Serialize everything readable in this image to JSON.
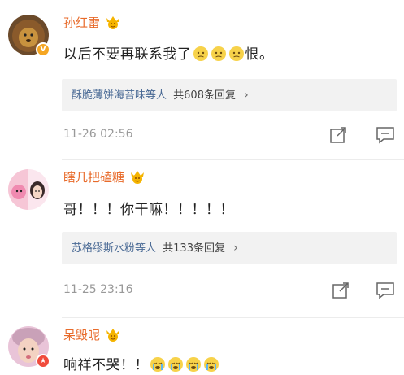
{
  "comments": [
    {
      "username": "孙红雷",
      "content": "以后不要再联系我了",
      "content_suffix": "恨。",
      "emoji_count": 3,
      "reply_users": "酥脆薄饼海苔味等人",
      "reply_count": "共608条回复",
      "timestamp": "11-26 02:56",
      "badge": "v"
    },
    {
      "username": "瞎几把磕糖",
      "content": "哥！！！你干嘛！！！！！",
      "reply_users": "苏格缪斯水粉等人",
      "reply_count": "共133条回复",
      "timestamp": "11-25 23:16"
    },
    {
      "username": "呆毁呢",
      "content": "响祥不哭！！",
      "emoji_count": 4,
      "badge": "star"
    }
  ],
  "icons": {
    "vip": "crown-face-icon",
    "share": "share-icon",
    "comment": "comment-icon",
    "chevron": "chevron-right-icon"
  },
  "colors": {
    "username": "#e86b2b",
    "reply_link": "#4a6a95",
    "timestamp": "#999999"
  }
}
